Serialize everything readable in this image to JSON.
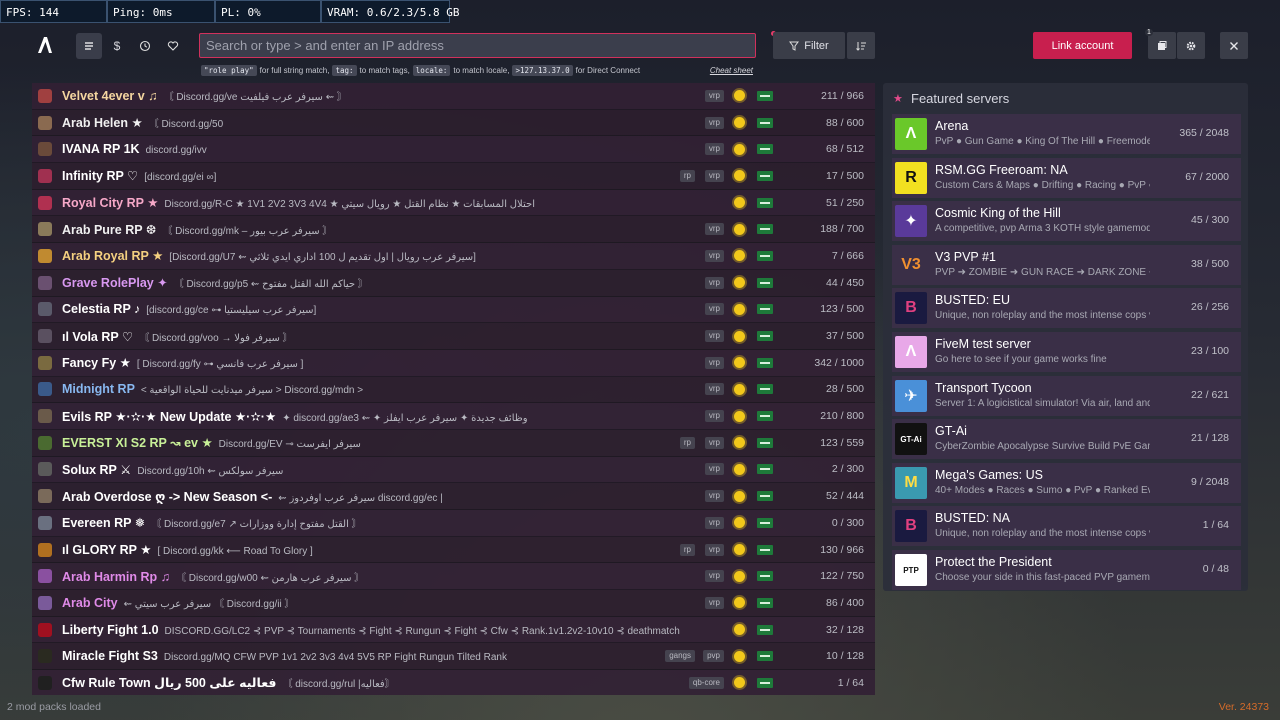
{
  "stats": {
    "fps": "FPS: 144",
    "ping": "Ping: 0ms",
    "pl": "PL: 0%",
    "vram": "VRAM: 0.6/2.3/5.8 GB"
  },
  "search": {
    "placeholder": "Search or type > and enter an IP address"
  },
  "hints": {
    "chip1": "\"role play\"",
    "t1": "for full string match,",
    "chip2": "tag:",
    "t2": "to match tags,",
    "chip3": "locale:",
    "t3": "to match locale,",
    "chip4": ">127.13.37.0",
    "t4": "for Direct Connect",
    "cheat": "Cheat sheet"
  },
  "toolbar": {
    "filter_label": "Filter",
    "link_label": "Link account",
    "notif_count": "1"
  },
  "icons": {
    "logo": "fivem-logo-icon",
    "list": "list-icon",
    "dollar": "dollar-icon",
    "history": "history-icon",
    "heart": "heart-icon",
    "filter": "filter-icon",
    "sort": "sort-icon",
    "notif": "notification-icon",
    "settings": "gear-icon",
    "close": "close-icon"
  },
  "colors": {
    "accent": "#d1315c",
    "link_button": "#c81f4e",
    "featured_star": "#e24a8a",
    "version": "#d46b2a"
  },
  "servers": [
    {
      "name": "Velvet 4ever v ♫",
      "desc": "〘 Discord.gg/ve سيرفر عرب فيلفيت ⇜ 〙",
      "tags": [
        "vrp"
      ],
      "count": "211 / 966",
      "color": "#f4d6a0",
      "icon": "#a04040"
    },
    {
      "name": "Arab Helen ★",
      "desc": "〘 Discord.gg/50",
      "tags": [
        "vrp"
      ],
      "count": "88 / 600",
      "color": "#f0f0f0",
      "icon": "#8a6a50"
    },
    {
      "name": "IVANA RP 1K",
      "desc": "discord.gg/ivv",
      "tags": [
        "vrp"
      ],
      "count": "68 / 512",
      "color": "#ffffff",
      "icon": "#6a4a3a"
    },
    {
      "name": "Infinity RP ♡",
      "desc": "[discord.gg/ei ∞]",
      "tags": [
        "rp",
        "vrp"
      ],
      "count": "17 / 500",
      "color": "#ffffff",
      "icon": "#a03050"
    },
    {
      "name": "Royal City RP ★",
      "desc": "Discord.gg/R-C ★ 1V1 2V2 3V3 4V4 ★ احتلال المسابقات ★ نظام القتل ★ رويال سيتي",
      "tags": [],
      "count": "51 / 250",
      "color": "#f6a8c8",
      "icon": "#b03050"
    },
    {
      "name": "Arab Pure RP ❆",
      "desc": "〘 Discord.gg/mk – سيرفر عرب بيور 〙",
      "tags": [
        "vrp"
      ],
      "count": "188 / 700",
      "color": "#f0f0f0",
      "icon": "#8a7a5a"
    },
    {
      "name": "Arab Royal RP ★",
      "desc": "[Discord.gg/U7 ⇜ سيرفر عرب رويال | اول تقديم ل 100 اداري ايدي ثلاثي]",
      "tags": [
        "vrp"
      ],
      "count": "7 / 666",
      "color": "#f4d080",
      "icon": "#c08a30"
    },
    {
      "name": "Grave RolePlay ✦",
      "desc": "〘 Discord.gg/p5 ⇜ حياكم الله القتل مفتوح 〙",
      "tags": [
        "vrp"
      ],
      "count": "44 / 450",
      "color": "#d898f0",
      "icon": "#6a5070"
    },
    {
      "name": "Celestia RP ♪",
      "desc": "[discord.gg/ce ⊶ سيرفر عرب سيليستيا]",
      "tags": [
        "vrp"
      ],
      "count": "123 / 500",
      "color": "#ffffff",
      "icon": "#5a5a6a"
    },
    {
      "name": "ıl Vola RP ♡",
      "desc": "〘 Discord.gg/voo → سيرفر فولا 〙",
      "tags": [
        "vrp"
      ],
      "count": "37 / 500",
      "color": "#ffffff",
      "icon": "#5a5060"
    },
    {
      "name": "Fancy Fy ★",
      "desc": "[ Discord.gg/fy ⊶ سيرفر عرب فانسي ]",
      "tags": [
        "vrp"
      ],
      "count": "342 / 1000",
      "color": "#ffffff",
      "icon": "#7a6a40"
    },
    {
      "name": "Midnight RP",
      "desc": "< سيرفر ميدنايت للحياة الواقعية > Discord.gg/mdn >",
      "tags": [
        "vrp"
      ],
      "count": "28 / 500",
      "color": "#88b8f0",
      "icon": "#3a5a8a"
    },
    {
      "name": "Evils RP ★·✫·★ New Update ★·✫·★",
      "desc": "✦ discord.gg/ae3 ⇜ ✦ وظائف جديدة ✦ سيرفر عرب ايفلز",
      "tags": [
        "vrp"
      ],
      "count": "210 / 800",
      "color": "#ffffff",
      "icon": "#6a5a4a"
    },
    {
      "name": "EVERST XI S2 RP ↝ ev ★",
      "desc": "Discord.gg/EV ⊸ سيرفر ايفرست",
      "tags": [
        "rp",
        "vrp"
      ],
      "count": "123 / 559",
      "color": "#c8f098",
      "icon": "#4a6a30"
    },
    {
      "name": "Solux RP ⚔",
      "desc": "Discord.gg/10h ⇜ سيرفر سولكس",
      "tags": [
        "vrp"
      ],
      "count": "2 / 300",
      "color": "#ffffff",
      "icon": "#5a5a5a"
    },
    {
      "name": "Arab Overdose ღ -> New Season <-",
      "desc": "⇜ سيرفر عرب اوفردوز discord.gg/ec |",
      "tags": [
        "vrp"
      ],
      "count": "52 / 444",
      "color": "#ffffff",
      "icon": "#7a6a5a"
    },
    {
      "name": "Evereen RP ❅",
      "desc": "〘 Discord.gg/e7 ↗ القتل مفتوح إدارة ووزارات 〙",
      "tags": [
        "vrp"
      ],
      "count": "0 / 300",
      "color": "#ffffff",
      "icon": "#6a7080"
    },
    {
      "name": "ıl GLORY RP ★",
      "desc": "[ Discord.gg/kk ⟵ Road To Glory ]",
      "tags": [
        "rp",
        "vrp"
      ],
      "count": "130 / 966",
      "color": "#ffffff",
      "icon": "#b07020"
    },
    {
      "name": "Arab Harmin Rp ♫",
      "desc": "〘 Discord.gg/w00 ⇜ سيرفر عرب هارمن 〙",
      "tags": [
        "vrp"
      ],
      "count": "122 / 750",
      "color": "#e08ae8",
      "icon": "#8a50a0"
    },
    {
      "name": "Arab City",
      "desc": "⇜ سيرفر عرب سيتي 〘 Discord.gg/ii 〙",
      "tags": [
        "vrp"
      ],
      "count": "86 / 400",
      "color": "#e08ae8",
      "icon": "#7a5a9a"
    },
    {
      "name": "Liberty Fight 1.0",
      "desc": "DISCORD.GG/LC2 ⊰ PVP ⊰ Tournaments ⊰ Fight ⊰ Rungun ⊰ Fight ⊰ Cfw ⊰ Rank.1v1.2v2-10v10 ⊰ deathmatch",
      "tags": [],
      "count": "32 / 128",
      "color": "#ffffff",
      "icon": "#a01020"
    },
    {
      "name": "Miracle Fight S3",
      "desc": "Discord.gg/MQ CFW PVP 1v1 2v2 3v3 4v4 5V5 RP Fight Rungun Tilted Rank",
      "tags": [
        "gangs",
        "pvp"
      ],
      "count": "10 / 128",
      "color": "#ffffff",
      "icon": "#2a2a20"
    },
    {
      "name": "Cfw Rule Town فعاليه على 500 ريال",
      "desc": "〘 discord.gg/rul |فعاليه〙",
      "tags": [
        "qb-core"
      ],
      "count": "1 / 64",
      "color": "#ffffff",
      "icon": "#202020"
    }
  ],
  "featured": {
    "title": "Featured servers",
    "items": [
      {
        "name": "Arena",
        "desc": "PvP ● Gun Game ● King Of The Hill ● Freemode",
        "count": "365 / 2048",
        "bg": "#6ac82a",
        "fg": "#ffffff",
        "glyph": "Λ"
      },
      {
        "name": "RSM.GG Freeroam: NA",
        "desc": "Custom Cars & Maps ● Drifting ● Racing ● PvP ●",
        "count": "67 / 2000",
        "bg": "#f2e020",
        "fg": "#111111",
        "glyph": "R"
      },
      {
        "name": "Cosmic King of the Hill",
        "desc": "A competitive, pvp Arma 3 KOTH style gamemode",
        "count": "45 / 300",
        "bg": "#5a3a9a",
        "fg": "#ffffff",
        "glyph": "✦"
      },
      {
        "name": "V3 PVP #1",
        "desc": "PVP ➜ ZOMBIE ➜ GUN RACE ➜ DARK ZONE ➜ F",
        "count": "38 / 500",
        "bg": "#3a2f47",
        "fg": "#f09030",
        "glyph": "V3"
      },
      {
        "name": "BUSTED: EU",
        "desc": "Unique, non roleplay and the most intense cops vs",
        "count": "26 / 256",
        "bg": "#1a1a40",
        "fg": "#e04080",
        "glyph": "B"
      },
      {
        "name": "FiveM test server",
        "desc": "Go here to see if your game works fine",
        "count": "23 / 100",
        "bg": "#e8a8e8",
        "fg": "#ffffff",
        "glyph": "Λ"
      },
      {
        "name": "Transport Tycoon",
        "desc": "Server 1: A logicistical simulator! Via air, land and sea",
        "count": "22 / 621",
        "bg": "#4a90d8",
        "fg": "#ffffff",
        "glyph": "✈"
      },
      {
        "name": "GT-Ai",
        "desc": "CyberZombie Apocalypse Survive Build PvE Gang",
        "count": "21 / 128",
        "bg": "#111111",
        "fg": "#ffffff",
        "glyph": "GT-Ai"
      },
      {
        "name": "Mega's Games: US",
        "desc": "40+ Modes ● Races ● Sumo ● PvP ● Ranked Events",
        "count": "9 / 2048",
        "bg": "#3a9ab0",
        "fg": "#ffdd44",
        "glyph": "M"
      },
      {
        "name": "BUSTED: NA",
        "desc": "Unique, non roleplay and the most intense cops vs rob",
        "count": "1 / 64",
        "bg": "#1a1a40",
        "fg": "#e04080",
        "glyph": "B"
      },
      {
        "name": "Protect the President",
        "desc": "Choose your side in this fast-paced PVP gamemode",
        "count": "0 / 48",
        "bg": "#ffffff",
        "fg": "#111111",
        "glyph": "PTP"
      }
    ]
  },
  "footer": {
    "mods": "2 mod packs loaded",
    "version": "Ver. 24373"
  }
}
